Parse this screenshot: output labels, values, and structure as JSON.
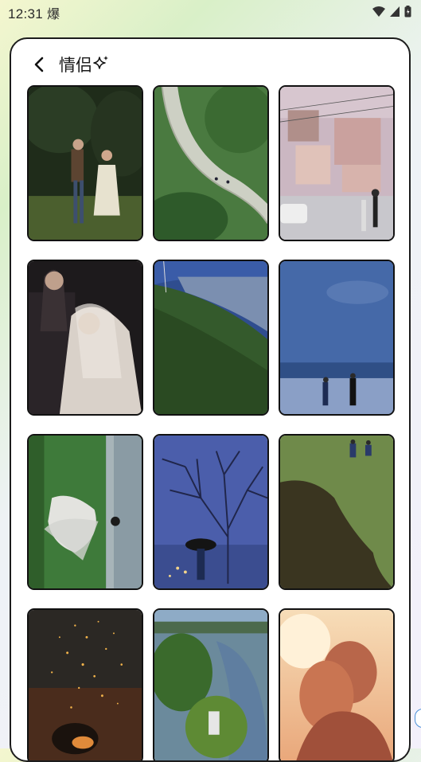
{
  "status_bar": {
    "time": "12:31",
    "extra_glyph": "爆",
    "icons": [
      "wifi-icon",
      "signal-icon",
      "battery-icon"
    ]
  },
  "header": {
    "title": "情侣",
    "back_icon": "chevron-left-icon",
    "decor_icon": "sparkle-icon"
  },
  "gallery": {
    "items": [
      {
        "name": "couple-running-field"
      },
      {
        "name": "winding-road-aerial"
      },
      {
        "name": "hillside-town-street"
      },
      {
        "name": "wedding-bride-veil"
      },
      {
        "name": "mountain-slope"
      },
      {
        "name": "seaside-couple-blue"
      },
      {
        "name": "bride-on-grass"
      },
      {
        "name": "bare-tree-umbrella"
      },
      {
        "name": "grass-field-shadow"
      },
      {
        "name": "sparks-night"
      },
      {
        "name": "river-trees"
      },
      {
        "name": "sunset-embrace"
      }
    ]
  }
}
